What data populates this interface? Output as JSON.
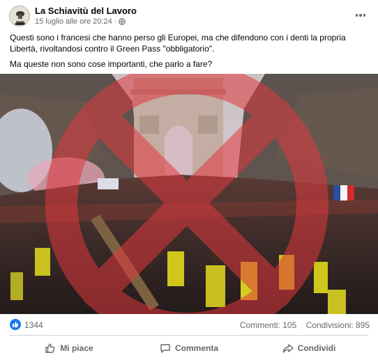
{
  "post": {
    "page_name": "La Schiavitù del Lavoro",
    "timestamp": "15 luglio alle ore 20:24",
    "separator": "·",
    "audience_icon": "globe-icon",
    "menu_icon": "more-horizontal-icon",
    "text_lines": [
      "Questi sono i francesi che hanno perso gli Europei, ma che difendono con i denti la propria Libertà, rivoltandosi contro il Green Pass \"obbligatorio\".",
      "Ma queste non sono cose importanti, che parlo a fare?"
    ],
    "image": {
      "description_icon": "protest-crowd-photo",
      "overlay_icon": "red-circle-x-watermark"
    }
  },
  "stats": {
    "reaction_icon": "like-icon",
    "reaction_count": "1344",
    "comments": "Commenti: 105",
    "shares": "Condivisioni: 895"
  },
  "actions": {
    "like_label": "Mi piace",
    "comment_label": "Commenta",
    "share_label": "Condividi"
  },
  "colors": {
    "accent": "#1877f2",
    "secondary_text": "#65676b",
    "watermark": "#e0383e"
  }
}
